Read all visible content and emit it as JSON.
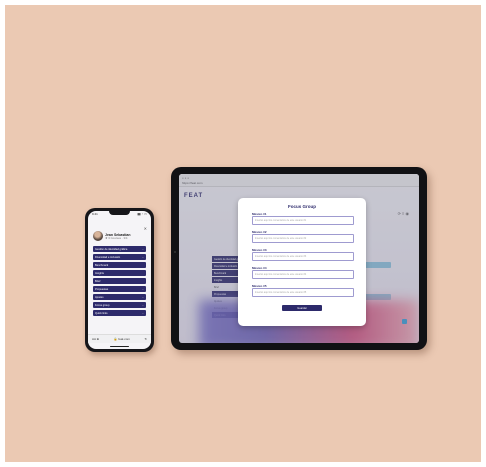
{
  "phone": {
    "status_time": "9:41",
    "status_right": "▮▮ ◔ ▭",
    "profile_name": "Jean Sebastian",
    "profile_sub": "★ 3 Courses · 3/4",
    "menu": [
      {
        "label": "Gestión de identidad gráfica",
        "chevron": "⌄"
      },
      {
        "label": "Diversidad e inclusión",
        "chevron": "⌄"
      },
      {
        "label": "Benchmark",
        "chevron": ""
      },
      {
        "label": "Insights",
        "chevron": ""
      },
      {
        "label": "Brief",
        "chevron": ""
      },
      {
        "label": "Propuestas",
        "chevron": "⌄"
      },
      {
        "label": "Ajustes",
        "chevron": "⌄"
      },
      {
        "label": "Focus group",
        "chevron": "⌄"
      },
      {
        "label": "Quick links",
        "chevron": "⌄"
      }
    ],
    "url_left": "AA ⊕",
    "url_text": "🔒 feat.com",
    "url_right": "↻"
  },
  "tablet": {
    "browser_dots": "● ● ●",
    "browser_url": "https://feat.com",
    "logo": "FEAT",
    "right_icons": "⟳ ≡ ◉",
    "bg_menu": [
      {
        "label": "Gestión de identidad gráfica",
        "style": "dark"
      },
      {
        "label": "Diversidad e inclusión",
        "style": "dark"
      },
      {
        "label": "Benchmark",
        "style": "dark"
      },
      {
        "label": "Insights",
        "style": "dark"
      },
      {
        "label": "Brief",
        "style": "light"
      },
      {
        "label": "Propuestas",
        "style": "dark"
      },
      {
        "label": "Ajustes",
        "style": "light"
      },
      {
        "label": "Focus group",
        "style": "light"
      },
      {
        "label": "Quick links",
        "style": "dark"
      }
    ],
    "modal": {
      "title": "Focus Group",
      "questions": [
        {
          "label": "Músico #1",
          "placeholder": "Insertar aquí los comentarios de este usuario #1"
        },
        {
          "label": "Músico #2",
          "placeholder": "Insertar aquí los comentarios de este usuario #2"
        },
        {
          "label": "Músico #3",
          "placeholder": "Insertar aquí los comentarios de este usuario #3"
        },
        {
          "label": "Músico #4",
          "placeholder": "Insertar aquí los comentarios de este usuario #4"
        },
        {
          "label": "Músico #5",
          "placeholder": "Insertar aquí los comentarios de este usuario #5"
        }
      ],
      "submit_label": "Guardar"
    }
  },
  "colors": {
    "background": "#ebc9b3",
    "brand": "#2d2a6b",
    "accent": "#3aa0d8"
  }
}
